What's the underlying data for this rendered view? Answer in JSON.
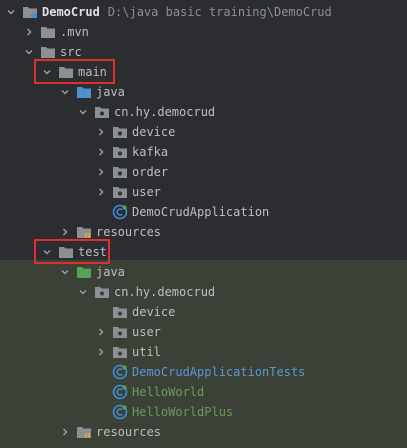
{
  "project": {
    "name": "DemoCrud",
    "path": "D:\\java basic training\\DemoCrud"
  },
  "tree": {
    "mvn": ".mvn",
    "src": "src",
    "main": "main",
    "main_java": "java",
    "main_pkg": "cn.hy.democrud",
    "main_device": "device",
    "main_kafka": "kafka",
    "main_order": "order",
    "main_user": "user",
    "main_app": "DemoCrudApplication",
    "main_resources": "resources",
    "test": "test",
    "test_java": "java",
    "test_pkg": "cn.hy.democrud",
    "test_device": "device",
    "test_user": "user",
    "test_util": "util",
    "test_app_tests": "DemoCrudApplicationTests",
    "test_hello": "HelloWorld",
    "test_hello_plus": "HelloWorldPlus",
    "test_resources": "resources"
  },
  "colors": {
    "background": "#2b2d30",
    "test_background": "#3b4136",
    "highlight_border": "#e02d2d",
    "folder": "#8c8f94",
    "source_folder": "#4e8fd6",
    "test_folder": "#5aa05a",
    "class_icon": "#3f8fd4",
    "test_class_text_blue": "#5b97d8",
    "test_class_text_green": "#6e9a5a"
  },
  "icons": {
    "folder": "folder-icon",
    "source_folder": "source-folder-icon",
    "test_folder": "test-folder-icon",
    "resources_folder": "resources-folder-icon",
    "class": "java-class-icon",
    "expanded": "chevron-down-icon",
    "collapsed": "chevron-right-icon"
  }
}
